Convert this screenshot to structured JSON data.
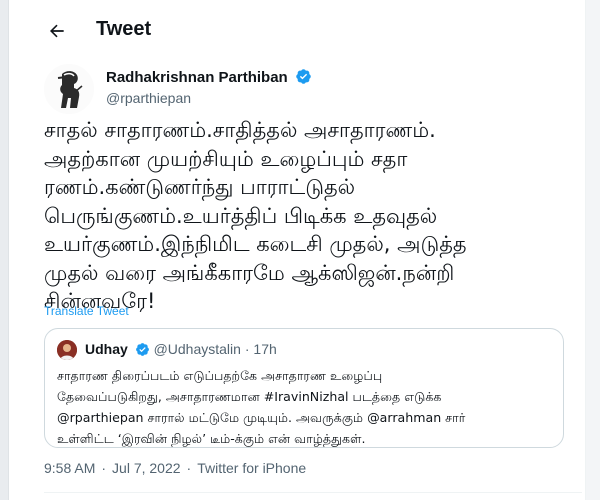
{
  "header": {
    "title": "Tweet"
  },
  "tweet": {
    "author_name": "Radhakrishnan Parthiban",
    "author_handle": "@rparthiepan",
    "text_lines": [
      "சாதல் சாதாரணம்.சாதித்தல் அசாதாரணம்.",
      "அதற்கான முயற்சியும் உழைப்பும் சதா",
      "ரணம்.கண்டுணர்ந்து பாராட்டுதல்",
      "பெருங்குணம்.உயர்த்திப் பிடிக்க உதவுதல்",
      "உயர்குணம்.இந்நிமிட கடைசி முதல், அடுத்த",
      "முதல் வரை அங்கீகாரமே ஆக்ஸிஜன்.நன்றி",
      "சின்னவரே!"
    ],
    "translate_label": "Translate Tweet",
    "time": "9:58 AM",
    "sep1": "·",
    "date": "Jul 7, 2022",
    "sep2": "·",
    "source": "Twitter for iPhone"
  },
  "quote": {
    "author_name": "Udhay",
    "author_handle": "@Udhaystalin",
    "sep": "·",
    "age": "17h",
    "text_lines": [
      "சாதாரண திரைப்படம் எடுப்பதற்கே அசாதாரண உழைப்பு",
      "தேவைப்படுகிறது, அசாதாரணமான #IravinNizhal படத்தை எடுக்க",
      "@rparthiepan சாரால் மட்டுமே முடியும். அவருக்கும் @arrahman சார்",
      "உள்ளிட்ட ‘இரவின் நிழல்’ டீம்-க்கும் என் வாழ்த்துகள்."
    ]
  },
  "colors": {
    "accent": "#1d9bf0",
    "secondary_text": "#536471",
    "border": "#cfd9de"
  },
  "icons": {
    "back": "arrow-left-icon",
    "verified": "verified-badge-icon"
  }
}
